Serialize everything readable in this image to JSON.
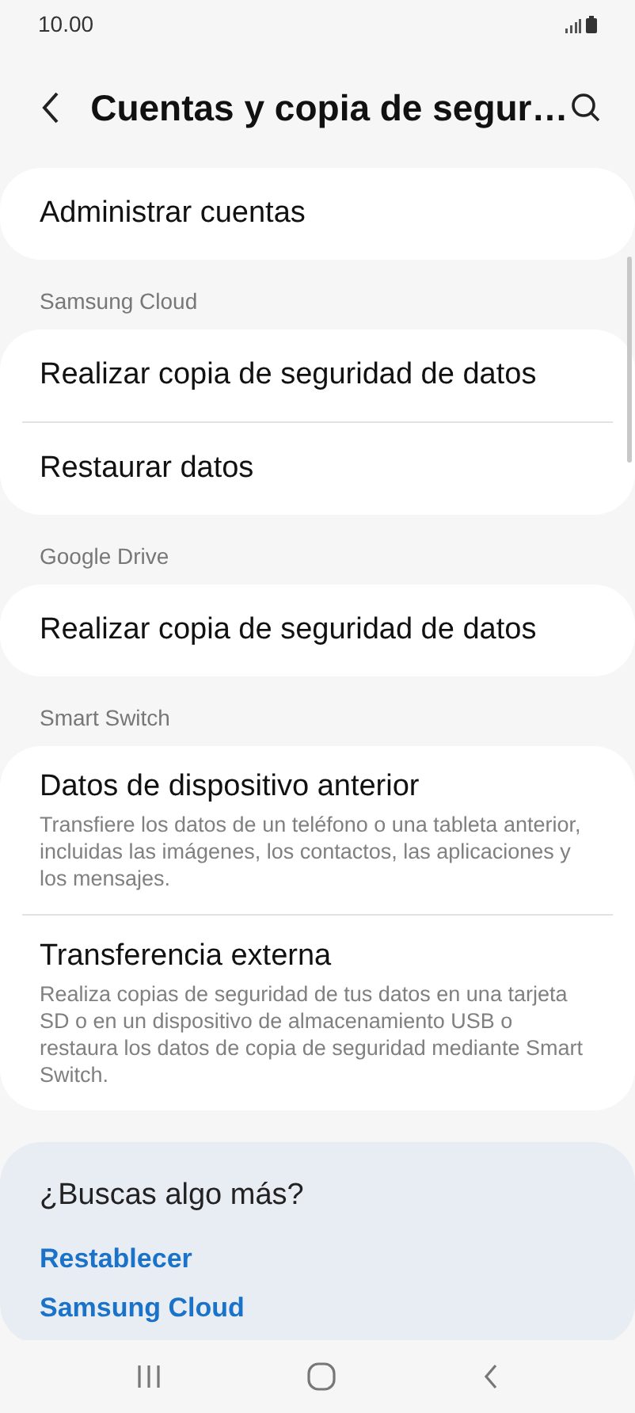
{
  "status_bar": {
    "time": "10.00"
  },
  "header": {
    "title": "Cuentas y copia de segur…"
  },
  "sections": [
    {
      "items": [
        {
          "title": "Administrar cuentas"
        }
      ]
    },
    {
      "heading": "Samsung Cloud",
      "items": [
        {
          "title": "Realizar copia de seguridad de datos"
        },
        {
          "title": "Restaurar datos"
        }
      ]
    },
    {
      "heading": "Google Drive",
      "items": [
        {
          "title": "Realizar copia de seguridad de datos"
        }
      ]
    },
    {
      "heading": "Smart Switch",
      "items": [
        {
          "title": "Datos de dispositivo anterior",
          "subtitle": "Transfiere los datos de un teléfono o una tableta anterior, incluidas las imágenes, los contactos, las aplicaciones y los mensajes."
        },
        {
          "title": "Transferencia externa",
          "subtitle": "Realiza copias de seguridad de tus datos en una tarjeta SD o en un dispositivo de almacenamiento USB o restaura los datos de copia de seguridad mediante Smart Switch."
        }
      ]
    }
  ],
  "more": {
    "title": "¿Buscas algo más?",
    "links": [
      "Restablecer",
      "Samsung Cloud"
    ]
  }
}
